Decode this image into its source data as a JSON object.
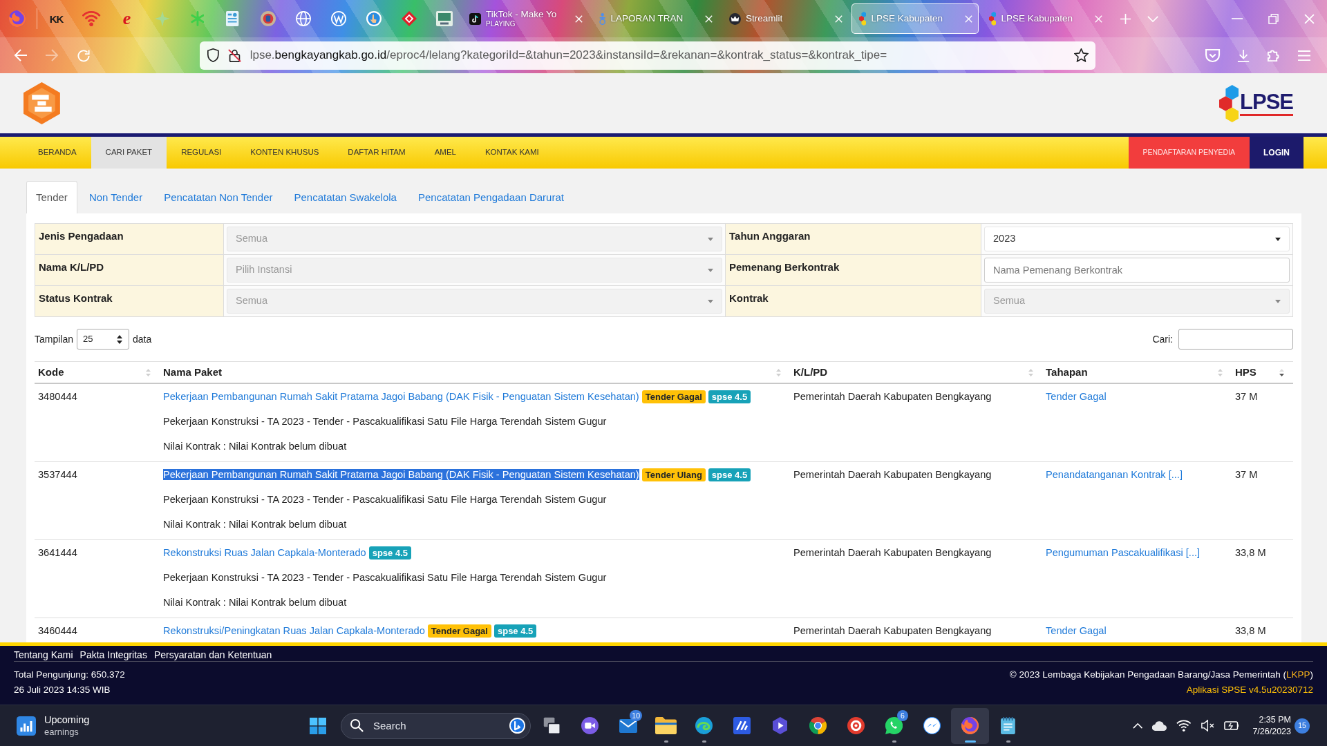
{
  "browser": {
    "pinned_tabs": [
      {
        "kind": "letters",
        "label": "KK"
      },
      {
        "kind": "signal"
      },
      {
        "kind": "script",
        "label": "e"
      },
      {
        "kind": "sparkle"
      },
      {
        "kind": "asterisk"
      },
      {
        "kind": "document"
      },
      {
        "kind": "emblem"
      },
      {
        "kind": "globe"
      },
      {
        "kind": "zigzag"
      },
      {
        "kind": "pointer"
      },
      {
        "kind": "diamond"
      },
      {
        "kind": "monitor"
      }
    ],
    "tabs": [
      {
        "kind": "note",
        "title": "TikTok - Make Yo",
        "status": "PLAYING",
        "selected": false
      },
      {
        "kind": "figure",
        "title": "LAPORAN TRAN",
        "selected": false
      },
      {
        "kind": "crown",
        "title": "Streamlit",
        "selected": false
      },
      {
        "kind": "hexagons",
        "title": "LPSE Kabupaten",
        "selected": true
      },
      {
        "kind": "hexagons",
        "title": "LPSE Kabupaten",
        "selected": false
      }
    ],
    "forward_disabled": true,
    "url": {
      "prefix": "lpse.",
      "host": "bengkayangkab.go.id",
      "path": "/eproc4/lelang?kategoriId=&tahun=2023&instansiId=&rekanan=&kontrak_status=&kontrak_tipe="
    }
  },
  "site_header": {
    "brand": "LPSE"
  },
  "navbar": {
    "items": [
      {
        "label": "BERANDA",
        "selected": false
      },
      {
        "label": "CARI PAKET",
        "selected": true
      },
      {
        "label": "REGULASI",
        "selected": false
      },
      {
        "label": "KONTEN KHUSUS",
        "selected": false
      },
      {
        "label": "DAFTAR HITAM",
        "selected": false
      },
      {
        "label": "AMEL",
        "selected": false
      },
      {
        "label": "KONTAK KAMI",
        "selected": false
      }
    ],
    "register": "PENDAFTARAN PENYEDIA",
    "login": "LOGIN"
  },
  "tabs": [
    {
      "label": "Tender",
      "selected": true
    },
    {
      "label": "Non Tender",
      "selected": false
    },
    {
      "label": "Pencatatan Non Tender",
      "selected": false
    },
    {
      "label": "Pencatatan Swakelola",
      "selected": false
    },
    {
      "label": "Pencatatan Pengadaan Darurat",
      "selected": false
    }
  ],
  "filters": [
    {
      "label": "Jenis Pengadaan",
      "kind": "dropdown",
      "placeholder": "Semua"
    },
    {
      "label": "Tahun Anggaran",
      "kind": "select",
      "value": "2023"
    },
    {
      "label": "Nama K/L/PD",
      "kind": "dropdown",
      "placeholder": "Pilih Instansi"
    },
    {
      "label": "Pemenang Berkontrak",
      "kind": "input",
      "placeholder": "Nama Pemenang Berkontrak"
    },
    {
      "label": "Status Kontrak",
      "kind": "dropdown",
      "placeholder": "Semua"
    },
    {
      "label": "Kontrak",
      "kind": "dropdown",
      "placeholder": "Semua"
    }
  ],
  "page_length": {
    "label": "Tampilan",
    "value": "25",
    "suffix": "data"
  },
  "search": {
    "label": "Cari:"
  },
  "table": {
    "columns": [
      {
        "label": "Kode",
        "sorted": false
      },
      {
        "label": "Nama Paket",
        "sorted": false
      },
      {
        "label": "K/L/PD",
        "sorted": false
      },
      {
        "label": "Tahapan",
        "sorted": false
      },
      {
        "label": "HPS",
        "sorted": true
      }
    ],
    "rows": [
      {
        "code": "3480444",
        "package": {
          "name": "Pekerjaan Pembangunan Rumah Sakit Pratama Jagoi Babang (DAK Fisik - Penguatan Sistem Kesehatan)",
          "highlighted": false,
          "tags": [
            {
              "label": "Tender Gagal",
              "color": "#ffc107"
            },
            {
              "label": "spse 4.5",
              "color": "#17a2b8"
            }
          ],
          "details": [
            "Pekerjaan Konstruksi - TA 2023 - Tender - Pascakualifikasi Satu File Harga Terendah Sistem Gugur",
            "Nilai Kontrak : Nilai Kontrak belum dibuat"
          ]
        },
        "agency": "Pemerintah Daerah Kabupaten Bengkayang",
        "stage": "Tender Gagal",
        "hps": "37 M"
      },
      {
        "code": "3537444",
        "package": {
          "name": "Pekerjaan Pembangunan Rumah Sakit Pratama Jagoi Babang (DAK Fisik - Penguatan Sistem Kesehatan)",
          "highlighted": true,
          "tags": [
            {
              "label": "Tender Ulang",
              "color": "#ffc107"
            },
            {
              "label": "spse 4.5",
              "color": "#17a2b8"
            }
          ],
          "details": [
            "Pekerjaan Konstruksi - TA 2023 - Tender - Pascakualifikasi Satu File Harga Terendah Sistem Gugur",
            "Nilai Kontrak : Nilai Kontrak belum dibuat"
          ]
        },
        "agency": "Pemerintah Daerah Kabupaten Bengkayang",
        "stage": "Penandatanganan Kontrak [...]",
        "hps": "37 M"
      },
      {
        "code": "3641444",
        "package": {
          "name": "Rekonstruksi Ruas Jalan Capkala-Monterado",
          "highlighted": false,
          "tags": [
            {
              "label": "spse 4.5",
              "color": "#17a2b8"
            }
          ],
          "details": [
            "Pekerjaan Konstruksi - TA 2023 - Tender - Pascakualifikasi Satu File Harga Terendah Sistem Gugur",
            "Nilai Kontrak : Nilai Kontrak belum dibuat"
          ]
        },
        "agency": "Pemerintah Daerah Kabupaten Bengkayang",
        "stage": "Pengumuman Pascakualifikasi [...]",
        "hps": "33,8 M"
      },
      {
        "code": "3460444",
        "package": {
          "name": "Rekonstruksi/Peningkatan Ruas Jalan Capkala-Monterado",
          "highlighted": false,
          "tags": [
            {
              "label": "Tender Gagal",
              "color": "#ffc107"
            },
            {
              "label": "spse 4.5",
              "color": "#17a2b8"
            }
          ]
        },
        "agency": "Pemerintah Daerah Kabupaten Bengkayang",
        "stage": "Tender Gagal",
        "hps": "33,8 M"
      }
    ]
  },
  "footer": {
    "links": [
      "Tentang Kami",
      "Pakta Integritas",
      "Persyaratan dan Ketentuan"
    ],
    "visitors": "Total Pengunjung: 650.372",
    "timestamp": "26 Juli 2023 14:35 WIB",
    "copyright": {
      "text": "© 2023 Lembaga Kebijakan Pengadaan Barang/Jasa Pemerintah (",
      "link": "LKPP",
      "end": ")"
    },
    "version": "Aplikasi SPSE v4.5u20230712"
  },
  "taskbar": {
    "widget": {
      "title": "Upcoming",
      "subtitle": "earnings"
    },
    "search": {
      "placeholder": "Search"
    },
    "apps": [
      {
        "kind": "taskview",
        "running": false,
        "active": false
      },
      {
        "kind": "videochat",
        "running": false,
        "active": false
      },
      {
        "kind": "mail",
        "badge": "10",
        "running": false,
        "active": false
      },
      {
        "kind": "folder",
        "running": true,
        "active": false
      },
      {
        "kind": "wave",
        "running": true,
        "active": false
      },
      {
        "kind": "slash",
        "running": false,
        "active": false
      },
      {
        "kind": "playhex",
        "running": false,
        "active": false
      },
      {
        "kind": "segmented",
        "running": false,
        "active": false
      },
      {
        "kind": "ring",
        "running": false,
        "active": false
      },
      {
        "kind": "phone",
        "badge": "6",
        "running": true,
        "active": false
      },
      {
        "kind": "chat",
        "running": false,
        "active": false
      },
      {
        "kind": "flame",
        "running": true,
        "active": true
      },
      {
        "kind": "notepad",
        "running": true,
        "active": false
      }
    ],
    "time": "2:35 PM",
    "date": "7/26/2023",
    "notifications": "15"
  }
}
